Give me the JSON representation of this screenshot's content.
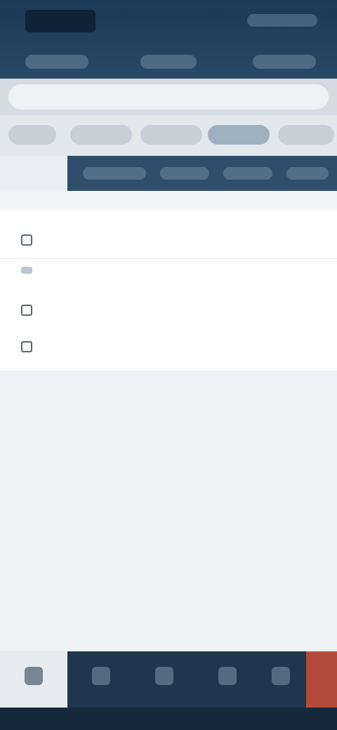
{
  "search": {
    "placeholder": ""
  },
  "list": {
    "items": [
      {
        "label": ""
      },
      {
        "label": ""
      },
      {
        "label": ""
      }
    ]
  },
  "colors": {
    "header_bg": "#1b3a58",
    "tab_bar_bg": "#2f4e6b",
    "bottom_nav_bg": "#1f364d",
    "alert": "#b44b3a",
    "page_bg": "#eef2f5"
  },
  "icons": {
    "bottom_nav": [
      "home-icon",
      "menu-icon",
      "list-icon",
      "calendar-icon",
      "notification-icon"
    ]
  }
}
